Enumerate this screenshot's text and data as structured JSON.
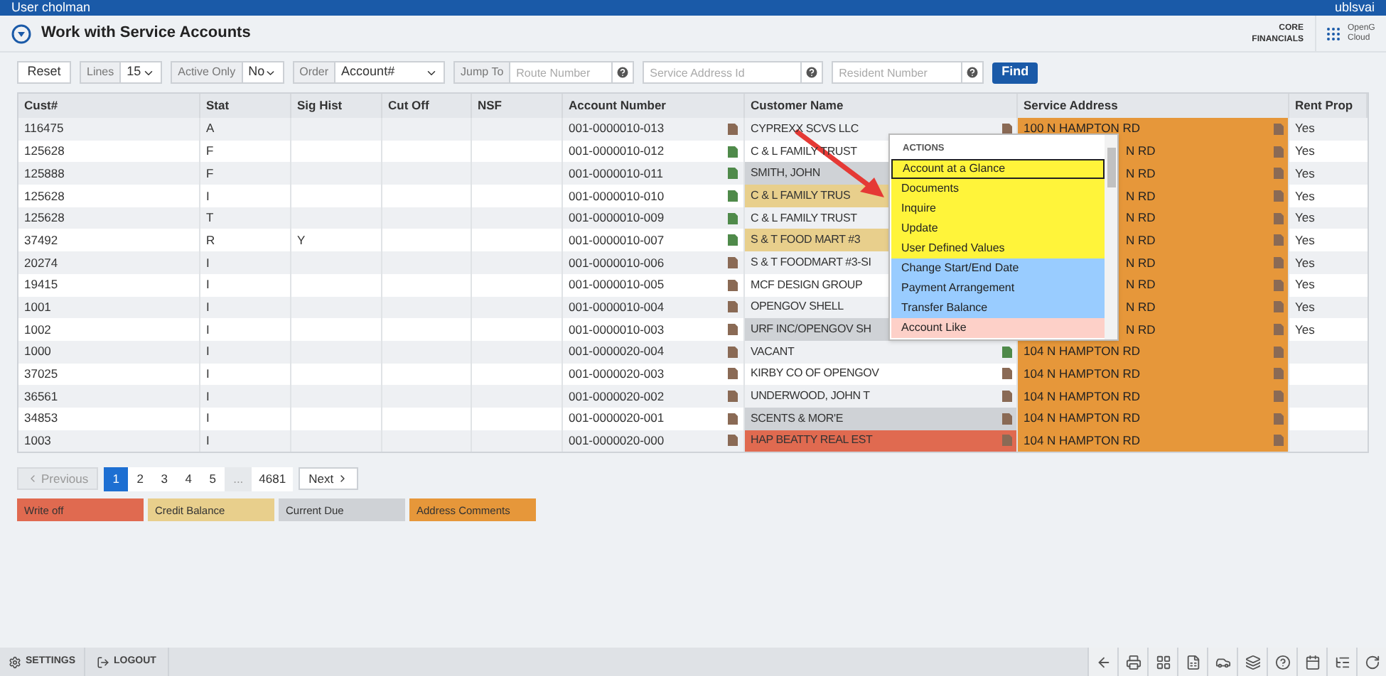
{
  "top_bar": {
    "user": "User cholman",
    "server": "ublsvai"
  },
  "header": {
    "title": "Work with Service Accounts",
    "product": "CORE FINANCIALS",
    "cloud": "OpenG Cloud"
  },
  "toolbar": {
    "reset": "Reset",
    "lines": {
      "label": "Lines",
      "value": "15"
    },
    "active_only": {
      "label": "Active Only",
      "value": "No"
    },
    "order": {
      "label": "Order",
      "value": "Account#"
    },
    "jump_to": {
      "label": "Jump To",
      "placeholder": "Route Number"
    },
    "service_address": {
      "placeholder": "Service Address Id"
    },
    "resident": {
      "placeholder": "Resident Number"
    },
    "find": "Find"
  },
  "table": {
    "columns": [
      "Cust#",
      "Stat",
      "Sig Hist",
      "Cut Off",
      "NSF",
      "Account Number",
      "Customer Name",
      "Service Address",
      "Rent Prop"
    ],
    "rows": [
      {
        "cust": "116475",
        "stat": "A",
        "sig_hist": "",
        "account": "001-0000010-013",
        "account_icon": {
          "color": "#8a6a55"
        },
        "customer": {
          "name": "CYPREXX SCVS LLC"
        },
        "name_icon": {
          "color": "#8a6a55"
        },
        "address": "100 N HAMPTON RD",
        "rent": "Yes"
      },
      {
        "cust": "125628",
        "stat": "F",
        "sig_hist": "",
        "account": "001-0000010-012",
        "account_icon": {
          "color": "#4f8a4a"
        },
        "customer": {
          "name": "C & L FAMILY TRUST"
        },
        "address": "N RD",
        "rent": "Yes"
      },
      {
        "cust": "125888",
        "stat": "F",
        "sig_hist": "",
        "account": "001-0000010-011",
        "account_icon": {
          "color": "#4f8a4a"
        },
        "customer": {
          "name": "SMITH, JOHN",
          "color": "#cfd2d6"
        },
        "address": "N RD",
        "rent": "Yes"
      },
      {
        "cust": "125628",
        "stat": "I",
        "sig_hist": "",
        "account": "001-0000010-010",
        "account_icon": {
          "color": "#4f8a4a"
        },
        "customer": {
          "name": "C & L FAMILY TRUS",
          "color": "#e8cf8c"
        },
        "address": "N RD",
        "rent": "Yes"
      },
      {
        "cust": "125628",
        "stat": "T",
        "sig_hist": "",
        "account": "001-0000010-009",
        "account_icon": {
          "color": "#4f8a4a"
        },
        "customer": {
          "name": "C & L FAMILY TRUST"
        },
        "address": "N RD",
        "rent": "Yes"
      },
      {
        "cust": "37492",
        "stat": "R",
        "sig_hist": "Y",
        "account": "001-0000010-007",
        "account_icon": {
          "color": "#4f8a4a"
        },
        "customer": {
          "name": "S & T FOOD MART #3",
          "color": "#e8cf8c"
        },
        "address": "N RD",
        "rent": "Yes"
      },
      {
        "cust": "20274",
        "stat": "I",
        "sig_hist": "",
        "account": "001-0000010-006",
        "account_icon": {
          "color": "#8a6a55"
        },
        "customer": {
          "name": "S & T FOODMART #3-SI"
        },
        "address": "N RD",
        "rent": "Yes"
      },
      {
        "cust": "19415",
        "stat": "I",
        "sig_hist": "",
        "account": "001-0000010-005",
        "account_icon": {
          "color": "#8a6a55"
        },
        "customer": {
          "name": "MCF DESIGN GROUP"
        },
        "address": "N RD",
        "rent": "Yes"
      },
      {
        "cust": "1001",
        "stat": "I",
        "sig_hist": "",
        "account": "001-0000010-004",
        "account_icon": {
          "color": "#8a6a55"
        },
        "customer": {
          "name": "OPENGOV SHELL"
        },
        "address": "N RD",
        "rent": "Yes"
      },
      {
        "cust": "1002",
        "stat": "I",
        "sig_hist": "",
        "account": "001-0000010-003",
        "account_icon": {
          "color": "#8a6a55"
        },
        "customer": {
          "name": "URF INC/OPENGOV SH",
          "color": "#cfd2d6"
        },
        "address": "N RD",
        "rent": "Yes"
      },
      {
        "cust": "1000",
        "stat": "I",
        "sig_hist": "",
        "account": "001-0000020-004",
        "account_icon": {
          "color": "#8a6a55"
        },
        "customer": {
          "name": "VACANT"
        },
        "name_icon": {
          "color": "#4f8a4a"
        },
        "address": "104 N HAMPTON RD",
        "rent": ""
      },
      {
        "cust": "37025",
        "stat": "I",
        "sig_hist": "",
        "account": "001-0000020-003",
        "account_icon": {
          "color": "#8a6a55"
        },
        "customer": {
          "name": "KIRBY CO OF OPENGOV"
        },
        "name_icon": {
          "color": "#8a6a55"
        },
        "address": "104 N HAMPTON RD",
        "rent": ""
      },
      {
        "cust": "36561",
        "stat": "I",
        "sig_hist": "",
        "account": "001-0000020-002",
        "account_icon": {
          "color": "#8a6a55"
        },
        "customer": {
          "name": "UNDERWOOD, JOHN T"
        },
        "name_icon": {
          "color": "#8a6a55"
        },
        "address": "104 N HAMPTON RD",
        "rent": ""
      },
      {
        "cust": "34853",
        "stat": "I",
        "sig_hist": "",
        "account": "001-0000020-001",
        "account_icon": {
          "color": "#8a6a55"
        },
        "customer": {
          "name": "SCENTS & MOR'E",
          "color": "#cfd2d6"
        },
        "name_icon": {
          "color": "#8a6a55"
        },
        "address": "104 N HAMPTON RD",
        "rent": ""
      },
      {
        "cust": "1003",
        "stat": "I",
        "sig_hist": "",
        "account": "001-0000020-000",
        "account_icon": {
          "color": "#8a6a55"
        },
        "customer": {
          "name": "HAP BEATTY REAL EST",
          "color": "#e06a50"
        },
        "name_icon": {
          "color": "#8a6a55"
        },
        "address": "104 N HAMPTON RD",
        "rent": ""
      }
    ]
  },
  "actions_menu": {
    "title": "ACTIONS",
    "items": [
      {
        "label": "Account at a Glance",
        "color": "#fff43a",
        "selected": true
      },
      {
        "label": "Documents",
        "color": "#fff43a",
        "selected": false
      },
      {
        "label": "Inquire",
        "color": "#fff43a",
        "selected": false
      },
      {
        "label": "Update",
        "color": "#fff43a",
        "selected": false
      },
      {
        "label": "User Defined Values",
        "color": "#fff43a",
        "selected": false
      },
      {
        "label": "Change Start/End Date",
        "color": "#99ccff",
        "selected": false
      },
      {
        "label": "Payment Arrangement",
        "color": "#99ccff",
        "selected": false
      },
      {
        "label": "Transfer Balance",
        "color": "#99ccff",
        "selected": false
      },
      {
        "label": "Account Like",
        "color": "#fdd0c8",
        "selected": false
      }
    ]
  },
  "pagination": {
    "previous": "Previous",
    "pages": [
      {
        "label": "1",
        "selected": true
      },
      {
        "label": "2",
        "selected": false
      },
      {
        "label": "3",
        "selected": false
      },
      {
        "label": "4",
        "selected": false
      },
      {
        "label": "5",
        "selected": false
      },
      {
        "label": "...",
        "selected": false,
        "kind": "gap"
      },
      {
        "label": "4681",
        "selected": false
      }
    ],
    "next": "Next"
  },
  "legend": [
    {
      "label": "Write off",
      "color": "#e06a50"
    },
    {
      "label": "Credit Balance",
      "color": "#e8cf8c"
    },
    {
      "label": "Current Due",
      "color": "#cfd2d6"
    },
    {
      "label": "Address Comments",
      "color": "#e6973a"
    }
  ],
  "footer": {
    "settings": "SETTINGS",
    "logout": "LOGOUT"
  }
}
